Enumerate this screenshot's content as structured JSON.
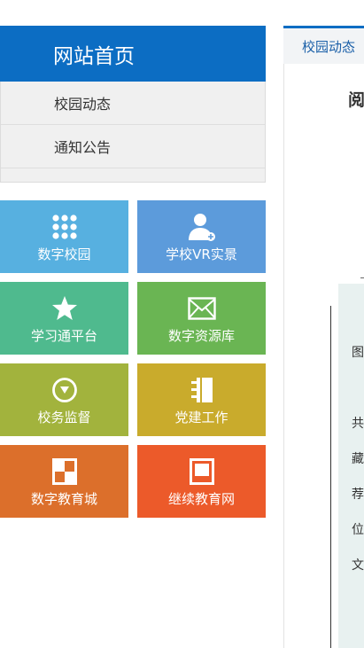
{
  "sidebar": {
    "title": "网站首页",
    "items": [
      {
        "label": "校园动态"
      },
      {
        "label": "通知公告"
      }
    ]
  },
  "tiles": [
    {
      "label": "数字校园",
      "icon": "grid-icon",
      "color": "#57b0e0"
    },
    {
      "label": "学校VR实景",
      "icon": "user-add-icon",
      "color": "#5c9bdb"
    },
    {
      "label": "学习通平台",
      "icon": "star-icon",
      "color": "#4fba8e"
    },
    {
      "label": "数字资源库",
      "icon": "mail-icon",
      "color": "#6ab553"
    },
    {
      "label": "校务监督",
      "icon": "play-circle-icon",
      "color": "#a2b33d"
    },
    {
      "label": "党建工作",
      "icon": "notebook-icon",
      "color": "#c9ab2c"
    },
    {
      "label": "数字教育城",
      "icon": "squares-icon",
      "color": "#dc6f2b"
    },
    {
      "label": "继续教育网",
      "icon": "frame-icon",
      "color": "#ec5a2a"
    }
  ],
  "main": {
    "tab": "校园动态",
    "title_partial": "阅",
    "info_labels": [
      "图",
      "共",
      "藏",
      "荐",
      "位",
      "文"
    ]
  }
}
